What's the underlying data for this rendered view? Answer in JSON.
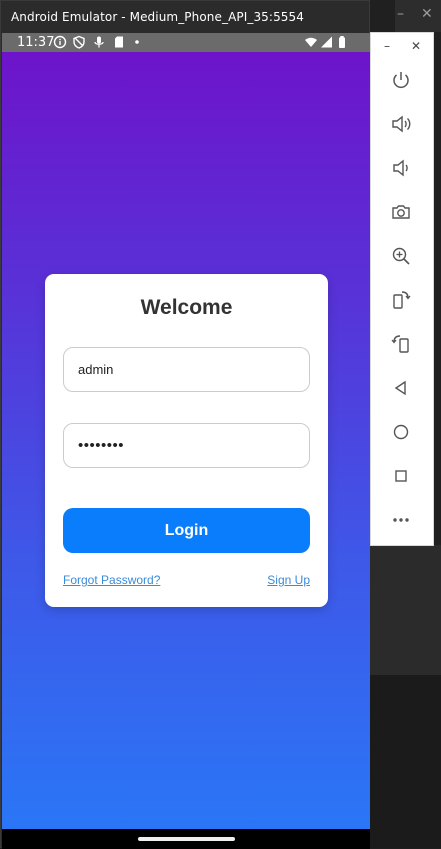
{
  "window": {
    "title": "Android Emulator - Medium_Phone_API_35:5554"
  },
  "background_window": {
    "minimize_glyph": "–",
    "close_glyph": "✕"
  },
  "status_bar": {
    "time": "11:37",
    "left_icons": [
      "info-icon",
      "shield-icon",
      "mic-icon",
      "sd-card-icon",
      "dot-icon"
    ],
    "right_icons": [
      "wifi-icon",
      "signal-icon",
      "battery-icon"
    ]
  },
  "login_card": {
    "title": "Welcome",
    "username_value": "admin",
    "password_value": "••••••••",
    "login_label": "Login",
    "forgot_label": "Forgot Password?",
    "signup_label": "Sign Up"
  },
  "toolbar": {
    "minimize_glyph": "–",
    "close_glyph": "✕",
    "buttons": [
      "power-icon",
      "volume-up-icon",
      "volume-down-icon",
      "camera-icon",
      "zoom-icon",
      "rotate-left-icon",
      "rotate-right-icon",
      "back-icon",
      "home-icon",
      "overview-icon",
      "more-icon"
    ]
  },
  "colors": {
    "gradient_top": "#6f12c9",
    "gradient_bottom": "#2a76f6",
    "button": "#0a7dfd",
    "link": "#3b8bd9"
  }
}
